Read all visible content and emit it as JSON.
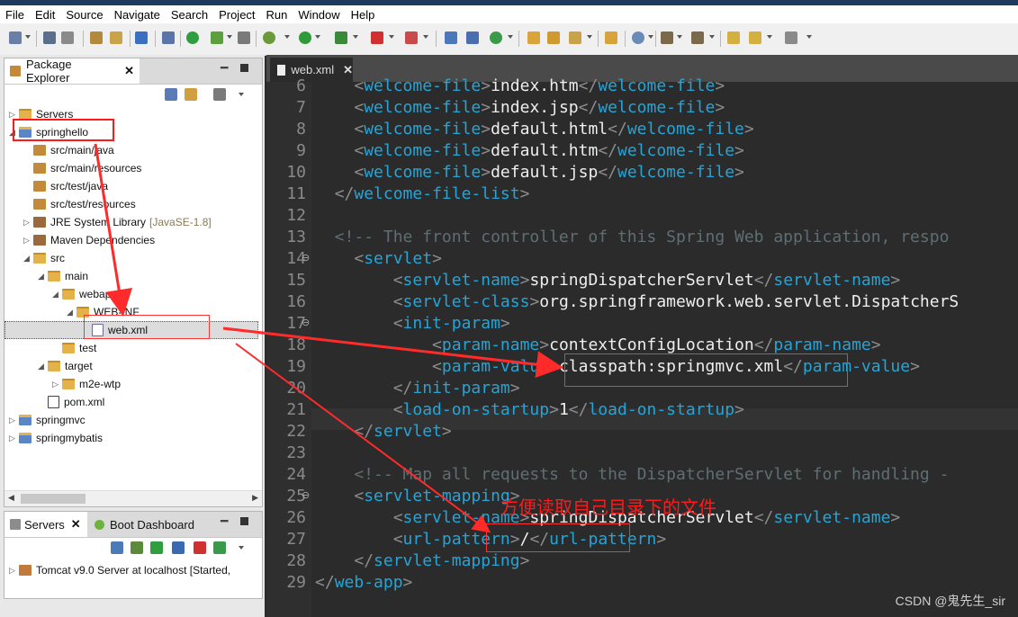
{
  "menu": [
    "File",
    "Edit",
    "Source",
    "Navigate",
    "Search",
    "Project",
    "Run",
    "Window",
    "Help"
  ],
  "package_explorer": {
    "title": "Package Explorer",
    "tree": [
      {
        "label": "Servers",
        "icon": "folder-icon",
        "twisty": "▷"
      },
      {
        "label": "springhello",
        "icon": "project-icon",
        "twisty": "◢"
      },
      {
        "label": "src/main/java",
        "icon": "package-folder-icon",
        "twisty": ""
      },
      {
        "label": "src/main/resources",
        "icon": "package-folder-icon",
        "twisty": ""
      },
      {
        "label": "src/test/java",
        "icon": "package-folder-icon",
        "twisty": ""
      },
      {
        "label": "src/test/resources",
        "icon": "package-folder-icon",
        "twisty": ""
      },
      {
        "label": "JRE System Library",
        "suffix": "[JavaSE-1.8]",
        "icon": "library-icon",
        "twisty": "▷"
      },
      {
        "label": "Maven Dependencies",
        "icon": "library-icon",
        "twisty": "▷"
      },
      {
        "label": "src",
        "icon": "folder-icon",
        "twisty": "◢"
      },
      {
        "label": "main",
        "icon": "folder-icon",
        "twisty": "◢"
      },
      {
        "label": "webapp",
        "icon": "folder-icon",
        "twisty": "◢"
      },
      {
        "label": "WEB-INF",
        "icon": "folder-icon",
        "twisty": "◢"
      },
      {
        "label": "web.xml",
        "icon": "xml-file-icon",
        "twisty": ""
      },
      {
        "label": "test",
        "icon": "folder-icon",
        "twisty": ""
      },
      {
        "label": "target",
        "icon": "folder-icon",
        "twisty": "◢"
      },
      {
        "label": "m2e-wtp",
        "icon": "folder-icon",
        "twisty": "▷"
      },
      {
        "label": "pom.xml",
        "icon": "pom-file-icon",
        "twisty": ""
      },
      {
        "label": "springmvc",
        "icon": "project-icon",
        "twisty": "▷"
      },
      {
        "label": "springmybatis",
        "icon": "project-icon",
        "twisty": "▷"
      }
    ]
  },
  "servers_view": {
    "tab1": "Servers",
    "tab2": "Boot Dashboard",
    "server_entry": "Tomcat v9.0 Server at localhost  [Started,"
  },
  "editor": {
    "tab": "web.xml",
    "lines": [
      {
        "n": "6",
        "fold": false,
        "parts": [
          [
            "t",
            "    "
          ],
          [
            "p",
            "<"
          ],
          [
            "t",
            "welcome-file"
          ],
          [
            "p",
            ">"
          ],
          [
            "x",
            "index.htm"
          ],
          [
            "p",
            "</"
          ],
          [
            "t",
            "welcome-file"
          ],
          [
            "p",
            ">"
          ]
        ]
      },
      {
        "n": "7",
        "fold": false,
        "parts": [
          [
            "t",
            "    "
          ],
          [
            "p",
            "<"
          ],
          [
            "t",
            "welcome-file"
          ],
          [
            "p",
            ">"
          ],
          [
            "x",
            "index.jsp"
          ],
          [
            "p",
            "</"
          ],
          [
            "t",
            "welcome-file"
          ],
          [
            "p",
            ">"
          ]
        ]
      },
      {
        "n": "8",
        "fold": false,
        "parts": [
          [
            "t",
            "    "
          ],
          [
            "p",
            "<"
          ],
          [
            "t",
            "welcome-file"
          ],
          [
            "p",
            ">"
          ],
          [
            "x",
            "default.html"
          ],
          [
            "p",
            "</"
          ],
          [
            "t",
            "welcome-file"
          ],
          [
            "p",
            ">"
          ]
        ]
      },
      {
        "n": "9",
        "fold": false,
        "parts": [
          [
            "t",
            "    "
          ],
          [
            "p",
            "<"
          ],
          [
            "t",
            "welcome-file"
          ],
          [
            "p",
            ">"
          ],
          [
            "x",
            "default.htm"
          ],
          [
            "p",
            "</"
          ],
          [
            "t",
            "welcome-file"
          ],
          [
            "p",
            ">"
          ]
        ]
      },
      {
        "n": "10",
        "fold": false,
        "parts": [
          [
            "t",
            "    "
          ],
          [
            "p",
            "<"
          ],
          [
            "t",
            "welcome-file"
          ],
          [
            "p",
            ">"
          ],
          [
            "x",
            "default.jsp"
          ],
          [
            "p",
            "</"
          ],
          [
            "t",
            "welcome-file"
          ],
          [
            "p",
            ">"
          ]
        ]
      },
      {
        "n": "11",
        "fold": false,
        "parts": [
          [
            "t",
            "  "
          ],
          [
            "p",
            "</"
          ],
          [
            "t",
            "welcome-file-list"
          ],
          [
            "p",
            ">"
          ]
        ]
      },
      {
        "n": "12",
        "fold": false,
        "parts": []
      },
      {
        "n": "13",
        "fold": false,
        "parts": [
          [
            "c",
            "  <!-- The front controller of this Spring Web application, respo"
          ]
        ]
      },
      {
        "n": "14",
        "fold": true,
        "parts": [
          [
            "t",
            "    "
          ],
          [
            "p",
            "<"
          ],
          [
            "t",
            "servlet"
          ],
          [
            "p",
            ">"
          ]
        ]
      },
      {
        "n": "15",
        "fold": false,
        "parts": [
          [
            "t",
            "        "
          ],
          [
            "p",
            "<"
          ],
          [
            "t",
            "servlet-name"
          ],
          [
            "p",
            ">"
          ],
          [
            "x",
            "springDispatcherServlet"
          ],
          [
            "p",
            "</"
          ],
          [
            "t",
            "servlet-name"
          ],
          [
            "p",
            ">"
          ]
        ]
      },
      {
        "n": "16",
        "fold": false,
        "parts": [
          [
            "t",
            "        "
          ],
          [
            "p",
            "<"
          ],
          [
            "t",
            "servlet-class"
          ],
          [
            "p",
            ">"
          ],
          [
            "x",
            "org.springframework.web.servlet.DispatcherS"
          ]
        ]
      },
      {
        "n": "17",
        "fold": true,
        "parts": [
          [
            "t",
            "        "
          ],
          [
            "p",
            "<"
          ],
          [
            "t",
            "init-param"
          ],
          [
            "p",
            ">"
          ]
        ]
      },
      {
        "n": "18",
        "fold": false,
        "parts": [
          [
            "t",
            "            "
          ],
          [
            "p",
            "<"
          ],
          [
            "t",
            "param-name"
          ],
          [
            "p",
            ">"
          ],
          [
            "x",
            "contextConfigLocation"
          ],
          [
            "p",
            "</"
          ],
          [
            "t",
            "param-name"
          ],
          [
            "p",
            ">"
          ]
        ]
      },
      {
        "n": "19",
        "fold": false,
        "parts": [
          [
            "t",
            "            "
          ],
          [
            "p",
            "<"
          ],
          [
            "t",
            "param-value"
          ],
          [
            "p",
            ">"
          ],
          [
            "x",
            "classpath:springmvc.xml"
          ],
          [
            "p",
            "</"
          ],
          [
            "t",
            "param-value"
          ],
          [
            "p",
            ">"
          ]
        ]
      },
      {
        "n": "20",
        "fold": false,
        "parts": [
          [
            "t",
            "        "
          ],
          [
            "p",
            "</"
          ],
          [
            "t",
            "init-param"
          ],
          [
            "p",
            ">"
          ]
        ]
      },
      {
        "n": "21",
        "fold": false,
        "parts": [
          [
            "t",
            "        "
          ],
          [
            "p",
            "<"
          ],
          [
            "t",
            "load-on-startup"
          ],
          [
            "p",
            ">"
          ],
          [
            "x",
            "1"
          ],
          [
            "p",
            "</"
          ],
          [
            "t",
            "load-on-startup"
          ],
          [
            "p",
            ">"
          ]
        ]
      },
      {
        "n": "22",
        "fold": false,
        "parts": [
          [
            "t",
            "    "
          ],
          [
            "p",
            "</"
          ],
          [
            "t",
            "servlet"
          ],
          [
            "p",
            ">"
          ]
        ]
      },
      {
        "n": "23",
        "fold": false,
        "parts": []
      },
      {
        "n": "24",
        "fold": false,
        "parts": [
          [
            "c",
            "    <!-- Map all requests to the DispatcherServlet for handling -"
          ]
        ]
      },
      {
        "n": "25",
        "fold": true,
        "parts": [
          [
            "t",
            "    "
          ],
          [
            "p",
            "<"
          ],
          [
            "t",
            "servlet-mapping"
          ],
          [
            "p",
            ">"
          ]
        ]
      },
      {
        "n": "26",
        "fold": false,
        "parts": [
          [
            "t",
            "        "
          ],
          [
            "p",
            "<"
          ],
          [
            "t",
            "servlet-name"
          ],
          [
            "p",
            ">"
          ],
          [
            "x",
            "springDispatcherServlet"
          ],
          [
            "p",
            "</"
          ],
          [
            "t",
            "servlet-name"
          ],
          [
            "p",
            ">"
          ]
        ]
      },
      {
        "n": "27",
        "fold": false,
        "parts": [
          [
            "t",
            "        "
          ],
          [
            "p",
            "<"
          ],
          [
            "t",
            "url-pattern"
          ],
          [
            "p",
            ">"
          ],
          [
            "x",
            "/"
          ],
          [
            "p",
            "</"
          ],
          [
            "t",
            "url-pattern"
          ],
          [
            "p",
            ">"
          ]
        ]
      },
      {
        "n": "28",
        "fold": false,
        "parts": [
          [
            "t",
            "    "
          ],
          [
            "p",
            "</"
          ],
          [
            "t",
            "servlet-mapping"
          ],
          [
            "p",
            ">"
          ]
        ]
      },
      {
        "n": "29",
        "fold": false,
        "parts": [
          [
            "p",
            "</"
          ],
          [
            "t",
            "web-app"
          ],
          [
            "p",
            ">"
          ]
        ]
      }
    ]
  },
  "annotation": "方便读取自己目录下的文件",
  "watermark": "CSDN @鬼先生_sir"
}
